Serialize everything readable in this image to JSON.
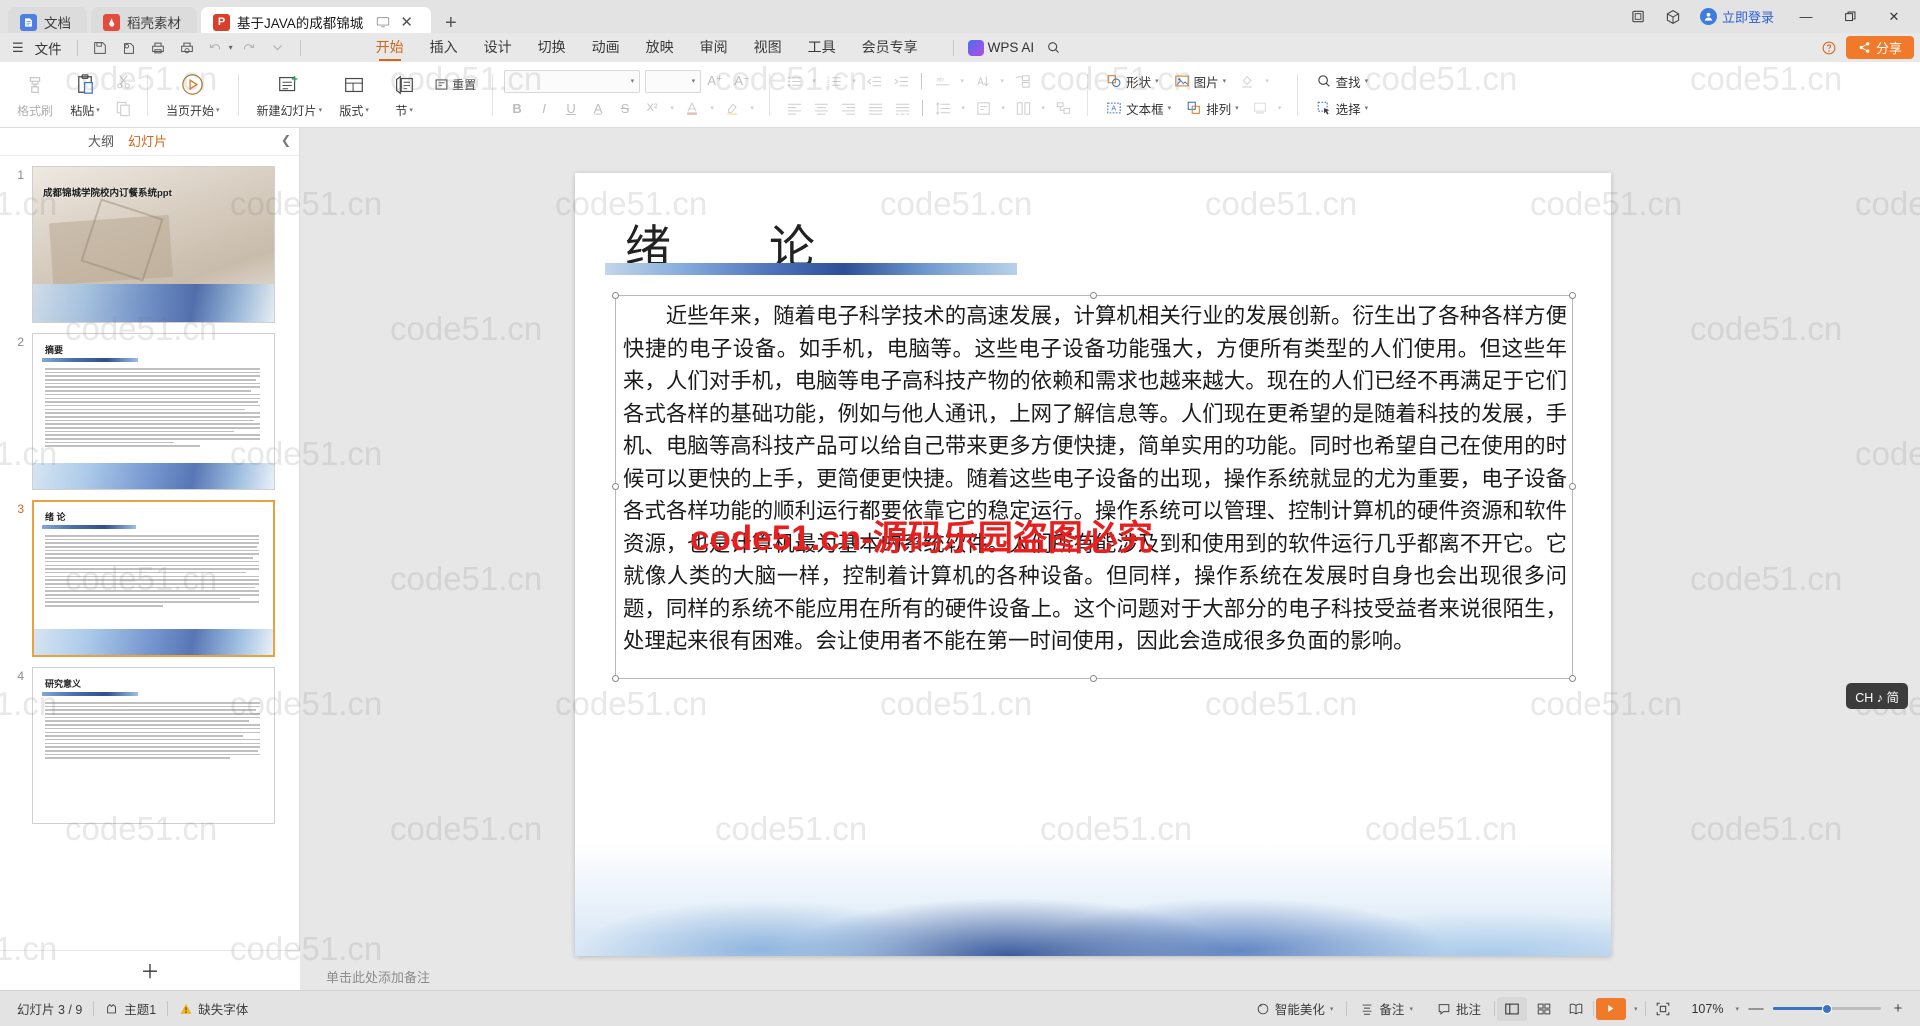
{
  "window": {
    "tabs": [
      {
        "label": "文档",
        "icon": "document-icon",
        "active": false
      },
      {
        "label": "稻壳素材",
        "icon": "daoke-icon",
        "active": false
      },
      {
        "label": "基于JAVA的成都锦城学院校...",
        "icon": "powerpoint-icon",
        "active": true
      }
    ],
    "new_tab_label": "+",
    "login_label": "立即登录",
    "minimize_label": "—",
    "maximize_label": "❐",
    "close_label": "✕"
  },
  "menubar": {
    "file_label": "文件",
    "quick_access": [
      "save-icon",
      "save-as-icon",
      "print-icon",
      "print-preview-icon",
      "undo-icon",
      "redo-icon",
      "customize-icon"
    ],
    "ribbon_tabs": [
      {
        "label": "开始",
        "active": true
      },
      {
        "label": "插入",
        "active": false
      },
      {
        "label": "设计",
        "active": false
      },
      {
        "label": "切换",
        "active": false
      },
      {
        "label": "动画",
        "active": false
      },
      {
        "label": "放映",
        "active": false
      },
      {
        "label": "审阅",
        "active": false
      },
      {
        "label": "视图",
        "active": false
      },
      {
        "label": "工具",
        "active": false
      },
      {
        "label": "会员专享",
        "active": false
      }
    ],
    "ai_label": "WPS AI",
    "search_icon": "search-icon",
    "share_label": "分享",
    "help_icon": "help-icon"
  },
  "ribbon": {
    "clipboard": {
      "format_painter": "格式刷",
      "paste": "粘贴",
      "cut_icon": "scissors-icon",
      "copy_icon": "copy-icon"
    },
    "slideshow": {
      "from_current": "当页开始"
    },
    "slides": {
      "new_slide": "新建幻灯片",
      "layout": "版式",
      "section": "节",
      "reset": "重置"
    },
    "font": {
      "font_name_placeholder": "",
      "font_size_placeholder": "",
      "grow_icon": "grow-font-icon",
      "shrink_icon": "shrink-font-icon",
      "bold": "B",
      "italic": "I",
      "underline": "U",
      "strikethrough": "S",
      "shadow_icon": "text-shadow-icon",
      "superscript": "X²",
      "highlight_icon": "text-highlight-icon",
      "font_color_icon": "font-color-icon",
      "clear_format_icon": "clear-format-icon",
      "char_spacing_icon": "character-spacing-icon"
    },
    "paragraph": {
      "bullets_icon": "bullet-list-icon",
      "numbering_icon": "numbered-list-icon",
      "decrease_indent_icon": "decrease-indent-icon",
      "increase_indent_icon": "increase-indent-icon",
      "align_left_icon": "align-left-icon",
      "align_center_icon": "align-center-icon",
      "align_right_icon": "align-right-icon",
      "justify_icon": "justify-icon",
      "distribute_icon": "distribute-icon",
      "line_spacing_icon": "line-spacing-icon",
      "text_direction_icon": "text-direction-icon",
      "align_text_icon": "align-text-icon",
      "smart_art_icon": "smart-art-icon",
      "columns_icon": "columns-icon"
    },
    "drawing": {
      "shapes": "形状",
      "textbox": "文本框",
      "picture": "图片",
      "arrange": "排列",
      "fill_icon": "shape-fill-icon",
      "quick_style_icon": "quick-style-icon"
    },
    "editing": {
      "find": "查找",
      "select": "选择"
    }
  },
  "left_panel": {
    "tabs": [
      {
        "label": "大纲",
        "active": false
      },
      {
        "label": "幻灯片",
        "active": true
      }
    ],
    "collapse_icon": "collapse-panel-icon",
    "add_slide_icon": "add-slide-icon",
    "thumbnails": [
      {
        "number": "1",
        "title": "成都锦城学院校内订餐系统ppt",
        "kind": "cover",
        "selected": false
      },
      {
        "number": "2",
        "title": "摘要",
        "kind": "text",
        "selected": false
      },
      {
        "number": "3",
        "title": "绪  论",
        "kind": "text",
        "selected": true
      },
      {
        "number": "4",
        "title": "研究意义",
        "kind": "text",
        "selected": false
      }
    ]
  },
  "slide": {
    "title": "绪　　论",
    "body": "近些年来，随着电子科学技术的高速发展，计算机相关行业的发展创新。衍生出了各种各样方便快捷的电子设备。如手机，电脑等。这些电子设备功能强大，方便所有类型的人们使用。但这些年来，人们对手机，电脑等电子高科技产物的依赖和需求也越来越大。现在的人们已经不再满足于它们各式各样的基础功能，例如与他人通讯，上网了解信息等。人们现在更希望的是随着科技的发展，手机、电脑等高科技产品可以给自己带来更多方便快捷，简单实用的功能。同时也希望自己在使用的时候可以更快的上手，更简便更快捷。随着这些电子设备的出现，操作系统就显的尤为重要，电子设备各式各样功能的顺利运行都要依靠它的稳定运行。操作系统可以管理、控制计算机的硬件资源和软件资源，也是计算机最为基本的系统软件。人们所有能涉及到和使用到的软件运行几乎都离不开它。它就像人类的大脑一样，控制着计算机的各种设备。但同样，操作系统在发展时自身也会出现很多问题，同样的系统不能应用在所有的硬件设备上。这个问题对于大部分的电子科技受益者来说很陌生，处理起来很有困难。会让使用者不能在第一时间使用，因此会造成很多负面的影响。"
  },
  "watermark": {
    "tile_text": "code51.cn",
    "red_text": "code51.cn-源码乐园盗图必究"
  },
  "notes": {
    "placeholder": "单击此处添加备注"
  },
  "status": {
    "slide_counter": "幻灯片 3 / 9",
    "theme": "主题1",
    "font_warning": "缺失字体",
    "beautify": "智能美化",
    "notes_btn": "备注",
    "comment_btn": "批注",
    "view_normal_icon": "normal-view-icon",
    "view_sorter_icon": "slide-sorter-icon",
    "view_reading_icon": "reading-view-icon",
    "play_icon": "play-icon",
    "fit_icon": "fit-to-window-icon",
    "zoom_level": "107%",
    "zoom_out": "—",
    "zoom_in": "+"
  },
  "ime": {
    "label": "CH ♪ 简"
  },
  "colors": {
    "accent_orange": "#d4641a",
    "share_orange": "#f07a29",
    "link_blue": "#2b5fd9",
    "selection_border": "#e8a33d",
    "watermark_red": "#e81f1f"
  }
}
